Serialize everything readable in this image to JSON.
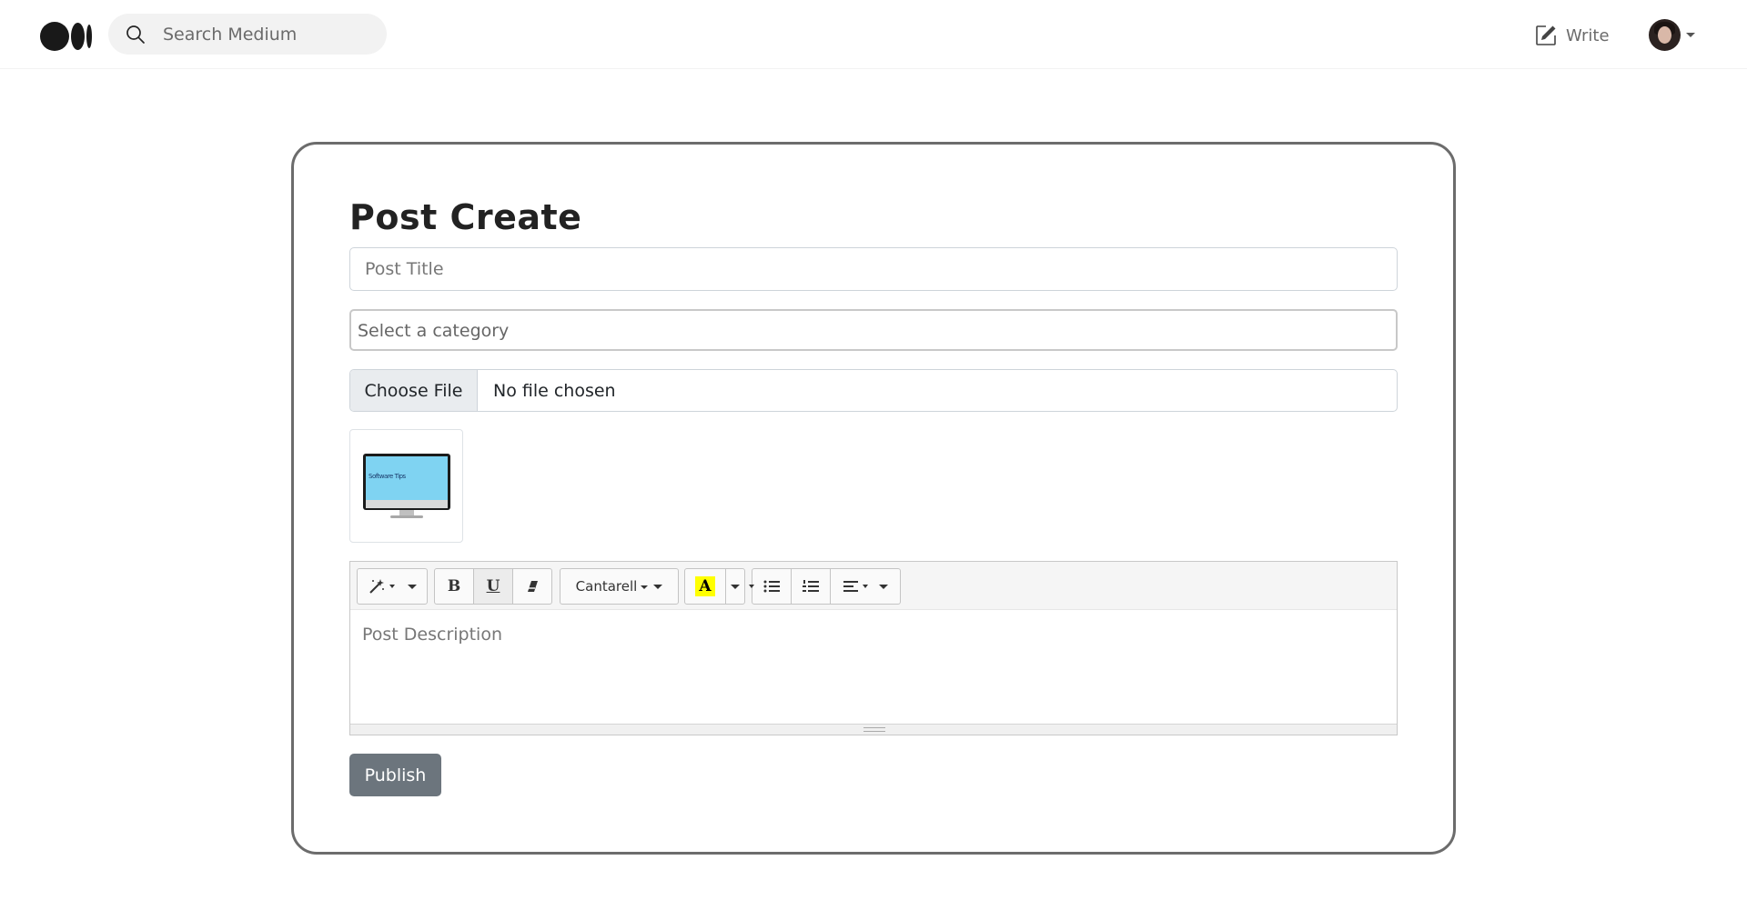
{
  "topbar": {
    "search_placeholder": "Search Medium",
    "write_label": "Write"
  },
  "form": {
    "title": "Post Create",
    "post_title_placeholder": "Post Title",
    "category_placeholder": "Select a category",
    "file_button_label": "Choose File",
    "file_status": "No file chosen",
    "thumbnail_text": "Software Tips"
  },
  "editor": {
    "font_name": "Cantarell",
    "description_placeholder": "Post Description",
    "highlight_color": "#ffff00",
    "toolbar_icons": [
      "magic-wand-icon",
      "bold-icon",
      "underline-icon",
      "eraser-icon",
      "font-family-dropdown",
      "text-color-icon",
      "unordered-list-icon",
      "ordered-list-icon",
      "align-icon"
    ]
  },
  "actions": {
    "publish_label": "Publish",
    "publish_color": "#6c757d"
  }
}
